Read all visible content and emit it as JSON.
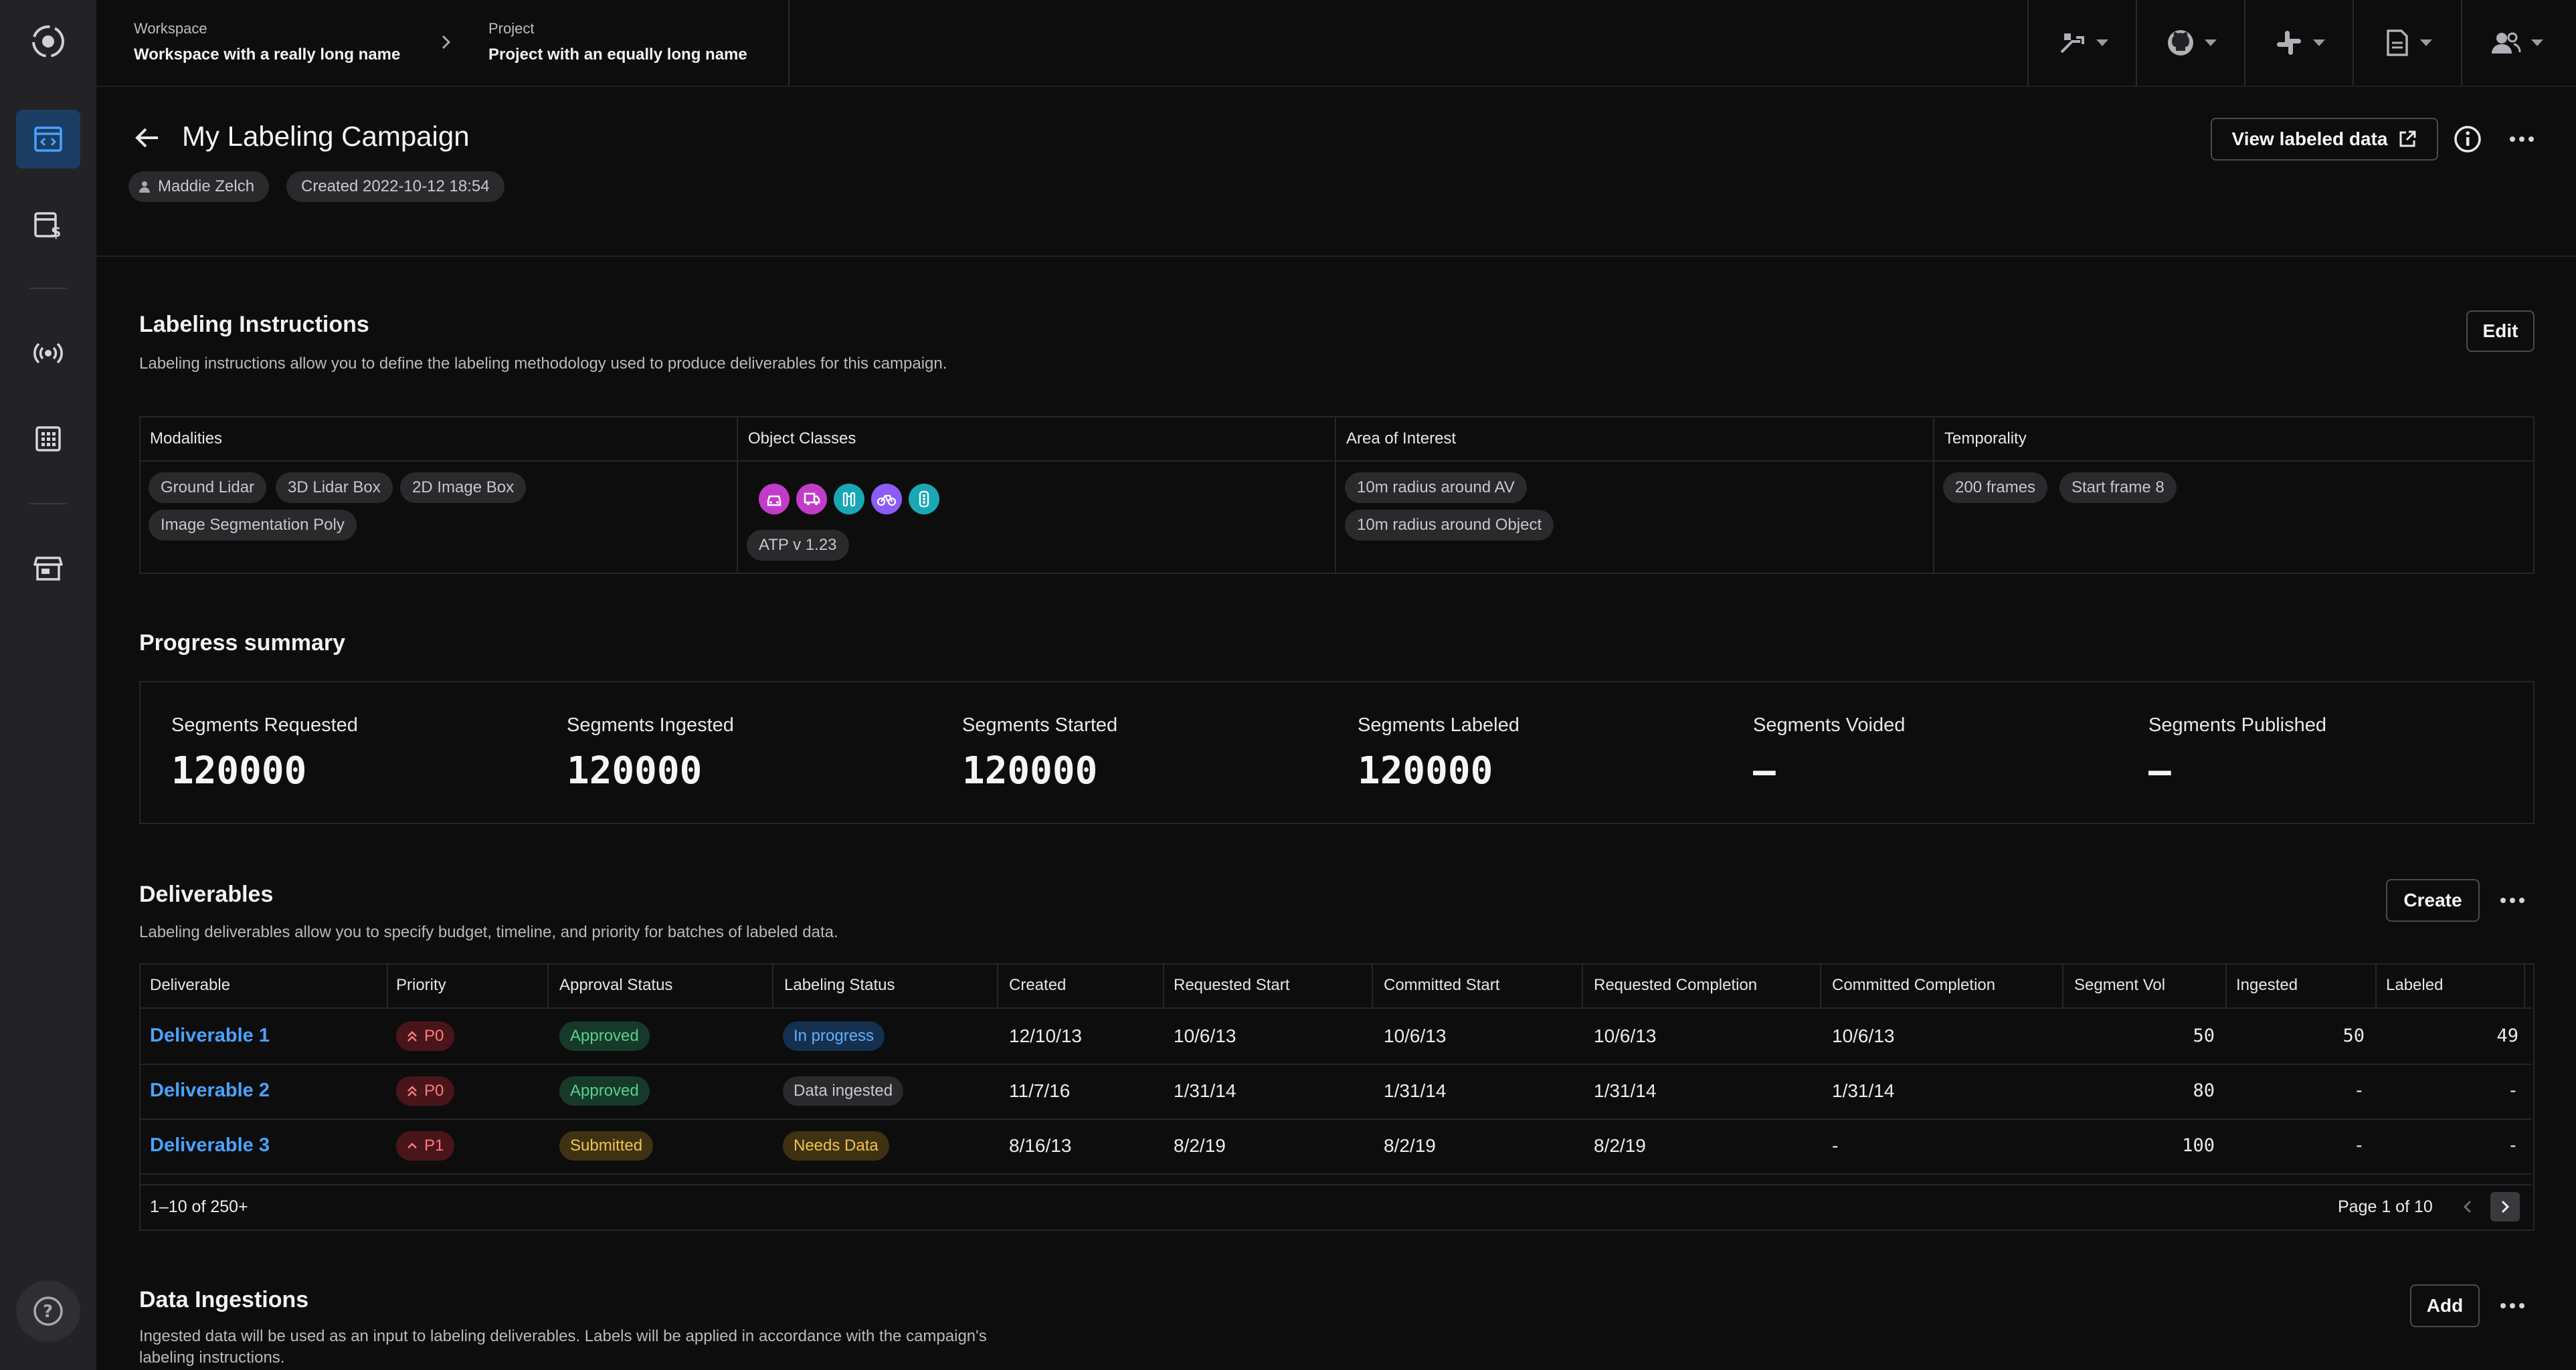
{
  "topbar": {
    "workspace_label": "Workspace",
    "workspace_value": "Workspace with a really long name",
    "project_label": "Project",
    "project_value": "Project with an equally long name"
  },
  "header": {
    "title": "My Labeling Campaign",
    "owner": "Maddie Zelch",
    "created": "Created 2022-10-12 18:54",
    "view_button": "View labeled data"
  },
  "instructions": {
    "title": "Labeling Instructions",
    "description": "Labeling instructions allow you to define the labeling methodology used to produce deliverables for this campaign.",
    "edit_label": "Edit",
    "columns": [
      "Modalities",
      "Object Classes",
      "Area of Interest",
      "Temporality"
    ],
    "modalities": [
      "Ground Lidar",
      "3D Lidar Box",
      "2D Image Box",
      "Image Segmentation Poly"
    ],
    "object_classes_version": "ATP v 1.23",
    "object_class_icons": [
      "car-icon",
      "truck-icon",
      "pedestrian-icon",
      "bicycle-icon",
      "traffic-light-icon"
    ],
    "object_class_colors": [
      "#c23cc9",
      "#c23cc9",
      "#1aa7b5",
      "#8b5cf6",
      "#1aa7b5"
    ],
    "areas": [
      "10m radius around AV",
      "10m radius around Object"
    ],
    "temporality": [
      "200 frames",
      "Start frame 8"
    ]
  },
  "progress": {
    "title": "Progress summary",
    "stats": [
      {
        "label": "Segments Requested",
        "value": "120000"
      },
      {
        "label": "Segments Ingested",
        "value": "120000"
      },
      {
        "label": "Segments Started",
        "value": "120000"
      },
      {
        "label": "Segments Labeled",
        "value": "120000"
      },
      {
        "label": "Segments Voided",
        "value": "–"
      },
      {
        "label": "Segments Published",
        "value": "–"
      }
    ]
  },
  "deliverables": {
    "title": "Deliverables",
    "description": "Labeling deliverables allow you to specify budget, timeline, and priority for batches of labeled data.",
    "create_label": "Create",
    "columns": [
      "Deliverable",
      "Priority",
      "Approval Status",
      "Labeling Status",
      "Created",
      "Requested Start",
      "Committed Start",
      "Requested Completion",
      "Committed Completion",
      "Segment Vol",
      "Ingested",
      "Labeled"
    ],
    "rows": [
      {
        "name": "Deliverable 1",
        "priority": "P0",
        "approval": "Approved",
        "labeling": "In progress",
        "created": "12/10/13",
        "req_start": "10/6/13",
        "com_start": "10/6/13",
        "req_completion": "10/6/13",
        "com_completion": "10/6/13",
        "segment_vol": "50",
        "ingested": "50",
        "labeled": "49"
      },
      {
        "name": "Deliverable 2",
        "priority": "P0",
        "approval": "Approved",
        "labeling": "Data ingested",
        "created": "11/7/16",
        "req_start": "1/31/14",
        "com_start": "1/31/14",
        "req_completion": "1/31/14",
        "com_completion": "1/31/14",
        "segment_vol": "80",
        "ingested": "-",
        "labeled": "-"
      },
      {
        "name": "Deliverable 3",
        "priority": "P1",
        "approval": "Submitted",
        "labeling": "Needs Data",
        "created": "8/16/13",
        "req_start": "8/2/19",
        "com_start": "8/2/19",
        "req_completion": "8/2/19",
        "com_completion": "-",
        "segment_vol": "100",
        "ingested": "-",
        "labeled": "-"
      }
    ],
    "range": "1–10 of 250+",
    "page": "Page 1 of 10"
  },
  "ingestions": {
    "title": "Data Ingestions",
    "description": "Ingested data will be used as an input to labeling deliverables. Labels will be applied in accordance with the campaign's labeling instructions.",
    "add_label": "Add"
  }
}
